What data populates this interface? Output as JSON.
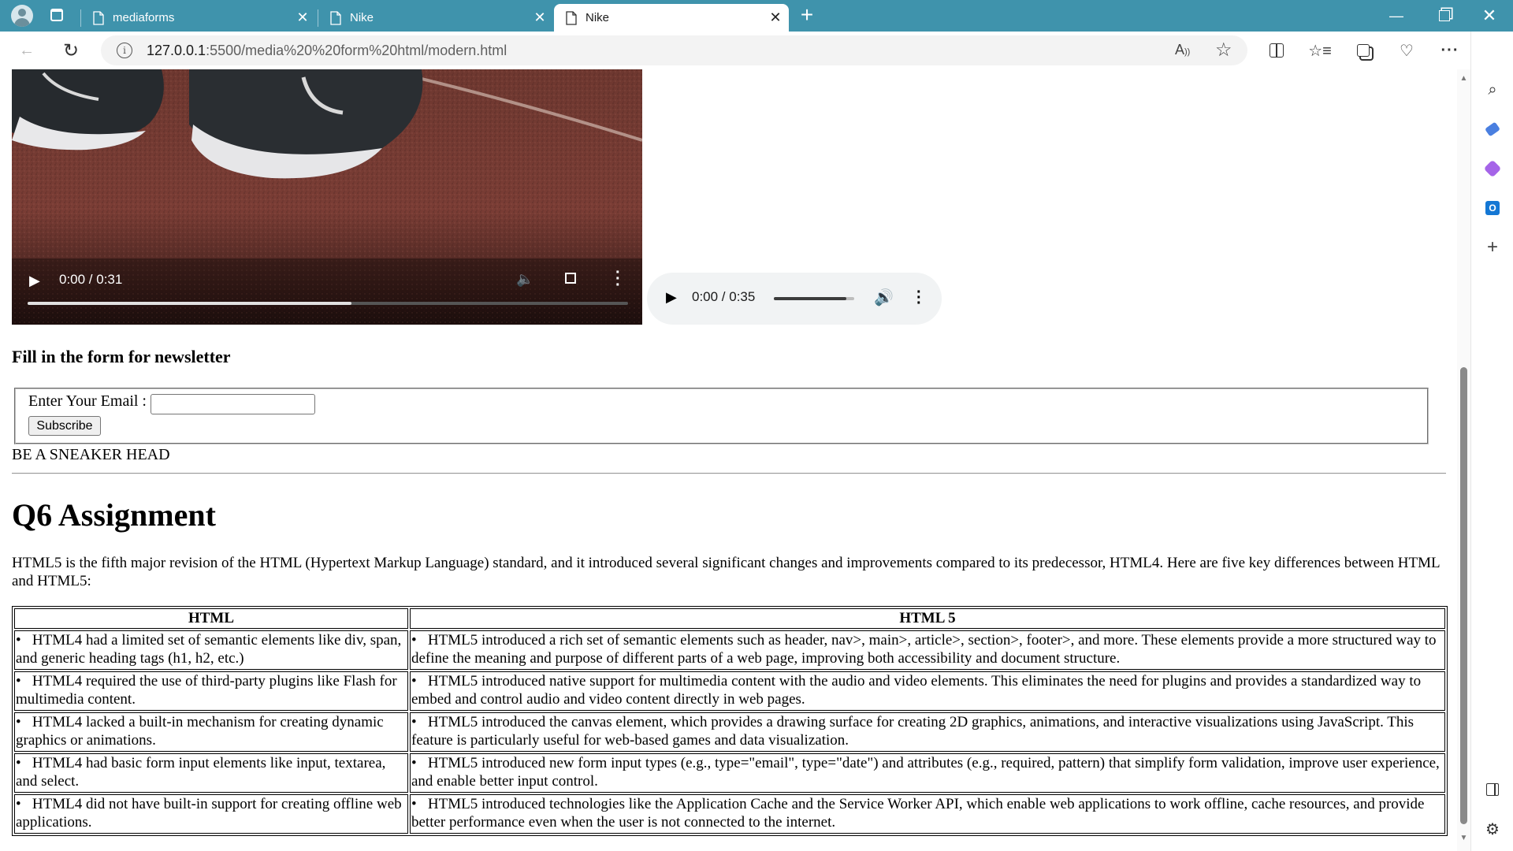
{
  "browser": {
    "tabs": [
      {
        "title": "mediaforms",
        "active": false
      },
      {
        "title": "Nike",
        "active": false
      },
      {
        "title": "Nike",
        "active": true
      }
    ],
    "url_host": "127.0.0.1",
    "url_rest": ":5500/media%20%20form%20html/modern.html",
    "accent": "#3f93ac"
  },
  "video": {
    "time": "0:00 / 0:31",
    "progress_fraction": 0.54
  },
  "audio": {
    "time": "0:00 / 0:35",
    "volume_fraction": 1.0
  },
  "form": {
    "heading": "Fill in the form for newsletter",
    "email_label": "Enter Your Email :",
    "email_value": "",
    "subscribe_label": "Subscribe"
  },
  "tagline": "BE A SNEAKER HEAD",
  "assignment": {
    "title": "Q6 Assignment",
    "intro": "HTML5 is the fifth major revision of the HTML (Hypertext Markup Language) standard, and it introduced several significant changes and improvements compared to its predecessor, HTML4. Here are five key differences between HTML and HTML5:",
    "headers": [
      "HTML",
      "HTML 5"
    ],
    "rows": [
      [
        "HTML4 had a limited set of semantic elements like div, span, and generic heading tags (h1, h2, etc.)",
        "HTML5 introduced a rich set of semantic elements such as header, nav>, main>, article>, section>, footer>, and more. These elements provide a more structured way to define the meaning and purpose of different parts of a web page, improving both accessibility and document structure."
      ],
      [
        "HTML4 required the use of third-party plugins like Flash for multimedia content.",
        "HTML5 introduced native support for multimedia content with the audio and video elements. This eliminates the need for plugins and provides a standardized way to embed and control audio and video content directly in web pages."
      ],
      [
        "HTML4 lacked a built-in mechanism for creating dynamic graphics or animations.",
        "HTML5 introduced the canvas element, which provides a drawing surface for creating 2D graphics, animations, and interactive visualizations using JavaScript. This feature is particularly useful for web-based games and data visualization."
      ],
      [
        "HTML4 had basic form input elements like input, textarea, and select.",
        "HTML5 introduced new form input types (e.g., type=\"email\", type=\"date\") and attributes (e.g., required, pattern) that simplify form validation, improve user experience, and enable better input control."
      ],
      [
        "HTML4 did not have built-in support for creating offline web applications.",
        "HTML5 introduced technologies like the Application Cache and the Service Worker API, which enable web applications to work offline, cache resources, and provide better performance even when the user is not connected to the internet."
      ]
    ]
  }
}
